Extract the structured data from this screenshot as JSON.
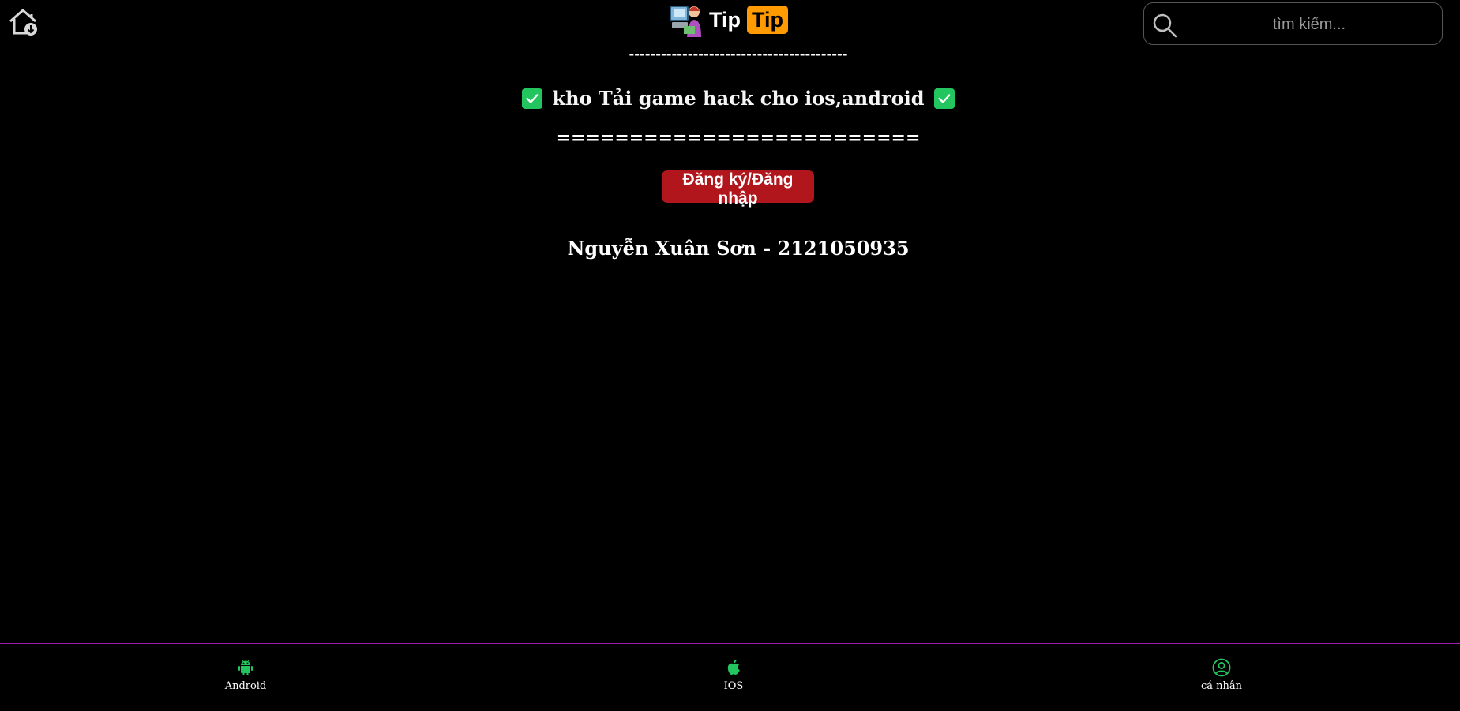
{
  "header": {
    "home_icon": "home-download-icon",
    "logo": {
      "text_1": "Tip",
      "text_2": "Tip",
      "accent_color": "#ff9a00"
    },
    "search": {
      "placeholder": "tìm kiếm...",
      "value": ""
    }
  },
  "main": {
    "divider_top": "-----------------------------------------",
    "headline": "kho Tải game hack cho ios,android",
    "headline_icon": "check-mark-icon",
    "divider_bottom": "=========================",
    "auth_button": "Đăng ký/Đăng nhập",
    "author": "Nguyễn Xuân Sơn - 2121050935"
  },
  "bottom_nav": {
    "accent_color": "#22c55e",
    "border_color": "#a21caf",
    "items": [
      {
        "label": "Android",
        "icon": "android-icon"
      },
      {
        "label": "IOS",
        "icon": "apple-icon"
      },
      {
        "label": "cá nhân",
        "icon": "user-circle-icon"
      }
    ]
  }
}
